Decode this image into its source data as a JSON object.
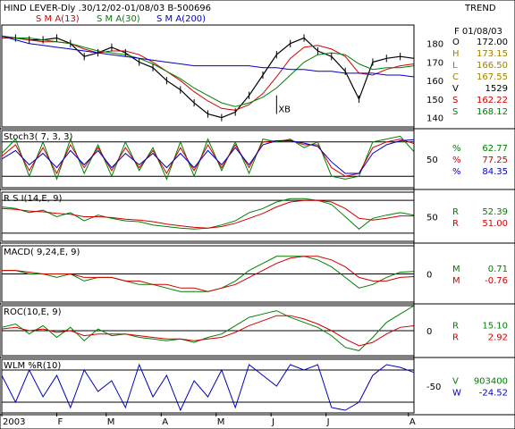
{
  "header": {
    "title": "HIND LEVER-Dly .30/12/02-01/08/03 B-500696",
    "trend": "TREND"
  },
  "colors": {
    "price": "#000000",
    "sma13": "#d00000",
    "sma30": "#008000",
    "sma200": "#0000c0",
    "grid": "#000000"
  },
  "chart_data": [
    {
      "panel": "price",
      "type": "line",
      "legend": [
        "S M A(13)",
        "S M A(30)",
        "S M A(200)"
      ],
      "yticks": [
        140,
        150,
        160,
        170,
        180
      ],
      "ylim": [
        135,
        190
      ],
      "annotation": "XB",
      "x": [
        0,
        5,
        10,
        15,
        20,
        25,
        30,
        35,
        40,
        45,
        50,
        55,
        60,
        65,
        70,
        75,
        80,
        85,
        90,
        95,
        100,
        105,
        110,
        115,
        120,
        125,
        130,
        135,
        140,
        145,
        150
      ],
      "series": [
        {
          "name": "Price",
          "values": [
            184,
            183,
            182,
            182,
            183,
            180,
            173,
            175,
            178,
            175,
            170,
            167,
            160,
            155,
            148,
            142,
            140,
            143,
            152,
            163,
            174,
            180,
            183,
            176,
            173,
            165,
            150,
            170,
            172,
            173,
            172
          ]
        },
        {
          "name": "S M A(13)",
          "values": [
            183,
            183,
            182,
            181,
            181,
            180,
            177,
            175,
            176,
            176,
            174,
            170,
            165,
            160,
            154,
            149,
            145,
            144,
            147,
            153,
            162,
            172,
            178,
            179,
            177,
            173,
            164,
            163,
            166,
            168,
            169
          ]
        },
        {
          "name": "S M A(30)",
          "values": [
            184,
            183,
            183,
            182,
            181,
            180,
            178,
            176,
            175,
            174,
            172,
            169,
            165,
            161,
            156,
            152,
            148,
            146,
            148,
            151,
            156,
            163,
            170,
            174,
            175,
            174,
            169,
            166,
            167,
            167,
            168
          ]
        },
        {
          "name": "S M A(200)",
          "values": [
            184,
            182,
            180,
            179,
            178,
            177,
            176,
            175,
            174,
            173,
            172,
            171,
            170,
            169,
            168,
            168,
            168,
            168,
            168,
            167,
            167,
            166,
            166,
            165,
            165,
            164,
            164,
            164,
            163,
            163,
            162
          ]
        }
      ],
      "readout": {
        "date": "F 01/08/03",
        "rows": [
          {
            "k": "O",
            "v": "172.00",
            "color": "#000000"
          },
          {
            "k": "H",
            "v": "173.15",
            "color": "#a08000"
          },
          {
            "k": "L",
            "v": "166.50",
            "color": "#a08000"
          },
          {
            "k": "C",
            "v": "167.55",
            "color": "#a08000"
          },
          {
            "k": "V",
            "v": "1529",
            "color": "#000000"
          },
          {
            "k": "S",
            "v": "162.22",
            "color": "#d00000"
          },
          {
            "k": "S",
            "v": "168.12",
            "color": "#008000"
          }
        ]
      }
    },
    {
      "panel": "stoch",
      "type": "line",
      "title": "Stoch3( 7, 3, 3)",
      "yticks": [
        50
      ],
      "ylim": [
        0,
        100
      ],
      "reference_lines": [
        20,
        80
      ],
      "x": [
        0,
        5,
        10,
        15,
        20,
        25,
        30,
        35,
        40,
        45,
        50,
        55,
        60,
        65,
        70,
        75,
        80,
        85,
        90,
        95,
        100,
        105,
        110,
        115,
        120,
        125,
        130,
        135,
        140,
        145,
        150
      ],
      "series": [
        {
          "name": "%K",
          "color": "#008000",
          "values": [
            60,
            85,
            20,
            80,
            15,
            85,
            25,
            75,
            20,
            80,
            30,
            70,
            15,
            80,
            20,
            85,
            30,
            80,
            25,
            85,
            80,
            85,
            70,
            80,
            20,
            15,
            20,
            80,
            85,
            90,
            63
          ]
        },
        {
          "name": "%D",
          "color": "#d00000",
          "values": [
            55,
            75,
            30,
            70,
            25,
            75,
            35,
            70,
            30,
            70,
            35,
            65,
            25,
            70,
            30,
            75,
            35,
            75,
            35,
            80,
            82,
            83,
            75,
            75,
            35,
            20,
            25,
            70,
            80,
            85,
            77
          ]
        },
        {
          "name": "%D2",
          "color": "#0000c0",
          "values": [
            50,
            65,
            40,
            60,
            35,
            65,
            40,
            65,
            35,
            60,
            40,
            60,
            35,
            60,
            35,
            65,
            40,
            70,
            40,
            75,
            82,
            82,
            78,
            72,
            45,
            25,
            25,
            60,
            75,
            82,
            84
          ]
        }
      ],
      "readout": [
        {
          "k": "%",
          "v": "62.77",
          "color": "#008000"
        },
        {
          "k": "%",
          "v": "77.25",
          "color": "#d00000"
        },
        {
          "k": "%",
          "v": "84.35",
          "color": "#0000c0"
        }
      ]
    },
    {
      "panel": "rsi",
      "type": "line",
      "title": "R S I(14,E, 9)",
      "yticks": [
        50
      ],
      "ylim": [
        20,
        80
      ],
      "reference_lines": [
        30,
        70
      ],
      "x": [
        0,
        5,
        10,
        15,
        20,
        25,
        30,
        35,
        40,
        45,
        50,
        55,
        60,
        65,
        70,
        75,
        80,
        85,
        90,
        95,
        100,
        105,
        110,
        115,
        120,
        125,
        130,
        135,
        140,
        145,
        150
      ],
      "series": [
        {
          "name": "RSI",
          "color": "#008000",
          "values": [
            62,
            60,
            55,
            58,
            50,
            55,
            45,
            52,
            48,
            45,
            44,
            40,
            38,
            36,
            35,
            36,
            40,
            45,
            55,
            60,
            68,
            72,
            72,
            70,
            65,
            50,
            35,
            48,
            52,
            55,
            52
          ]
        },
        {
          "name": "Signal",
          "color": "#d00000",
          "values": [
            60,
            59,
            57,
            56,
            54,
            53,
            50,
            50,
            49,
            47,
            46,
            44,
            41,
            39,
            37,
            36,
            38,
            42,
            48,
            54,
            62,
            68,
            70,
            70,
            68,
            60,
            48,
            46,
            48,
            51,
            51
          ]
        }
      ],
      "readout": [
        {
          "k": "R",
          "v": "52.39",
          "color": "#008000"
        },
        {
          "k": "R",
          "v": "51.00",
          "color": "#d00000"
        }
      ]
    },
    {
      "panel": "macd",
      "type": "line",
      "title": "MACD( 9,24,E, 9)",
      "yticks": [
        0
      ],
      "ylim": [
        -8,
        8
      ],
      "reference_lines": [
        0
      ],
      "x": [
        0,
        5,
        10,
        15,
        20,
        25,
        30,
        35,
        40,
        45,
        50,
        55,
        60,
        65,
        70,
        75,
        80,
        85,
        90,
        95,
        100,
        105,
        110,
        115,
        120,
        125,
        130,
        135,
        140,
        145,
        150
      ],
      "series": [
        {
          "name": "MACD",
          "color": "#008000",
          "values": [
            1,
            1,
            0,
            0,
            -1,
            0,
            -2,
            -1,
            -1,
            -2,
            -3,
            -3,
            -4,
            -5,
            -5,
            -5,
            -4,
            -2,
            1,
            3,
            5,
            5,
            5,
            4,
            2,
            -1,
            -4,
            -3,
            -1,
            0.5,
            0.71
          ]
        },
        {
          "name": "Signal",
          "color": "#d00000",
          "values": [
            1,
            1,
            0.5,
            0,
            0,
            0,
            -1,
            -1,
            -1,
            -2,
            -2,
            -3,
            -3,
            -4,
            -4,
            -5,
            -4,
            -3,
            -1,
            1,
            3,
            4.5,
            5,
            5,
            4,
            2,
            -1,
            -2,
            -2,
            -1,
            -0.76
          ]
        }
      ],
      "readout": [
        {
          "k": "M",
          "v": "0.71",
          "color": "#008000"
        },
        {
          "k": "M",
          "v": "-0.76",
          "color": "#d00000"
        }
      ]
    },
    {
      "panel": "roc",
      "type": "line",
      "title": "ROC(10,E, 9)",
      "yticks": [
        0
      ],
      "ylim": [
        -15,
        15
      ],
      "reference_lines": [
        0
      ],
      "x": [
        0,
        5,
        10,
        15,
        20,
        25,
        30,
        35,
        40,
        45,
        50,
        55,
        60,
        65,
        70,
        75,
        80,
        85,
        90,
        95,
        100,
        105,
        110,
        115,
        120,
        125,
        130,
        135,
        140,
        145,
        150
      ],
      "series": [
        {
          "name": "ROC",
          "color": "#008000",
          "values": [
            2,
            4,
            -2,
            3,
            -4,
            2,
            -6,
            1,
            -3,
            -2,
            -4,
            -5,
            -6,
            -5,
            -7,
            -4,
            -2,
            3,
            8,
            10,
            12,
            8,
            5,
            2,
            -3,
            -10,
            -12,
            -4,
            5,
            10,
            15
          ]
        },
        {
          "name": "Signal",
          "color": "#d00000",
          "values": [
            1,
            2,
            0,
            1,
            -1,
            0,
            -3,
            -2,
            -2,
            -2,
            -3,
            -4,
            -5,
            -5,
            -6,
            -5,
            -4,
            -1,
            3,
            6,
            9,
            9,
            7,
            4,
            0,
            -5,
            -9,
            -7,
            -2,
            2,
            2.92
          ]
        }
      ],
      "readout": [
        {
          "k": "R",
          "v": "15.10",
          "color": "#008000"
        },
        {
          "k": "R",
          "v": "2.92",
          "color": "#d00000"
        }
      ]
    },
    {
      "panel": "wlm",
      "type": "line",
      "title": "WLM %R(10)",
      "yticks": [
        -50
      ],
      "ylim": [
        -100,
        0
      ],
      "reference_lines": [
        -20,
        -80
      ],
      "x": [
        0,
        5,
        10,
        15,
        20,
        25,
        30,
        35,
        40,
        45,
        50,
        55,
        60,
        65,
        70,
        75,
        80,
        85,
        90,
        95,
        100,
        105,
        110,
        115,
        120,
        125,
        130,
        135,
        140,
        145,
        150
      ],
      "series": [
        {
          "name": "%R",
          "color": "#0000c0",
          "values": [
            -30,
            -80,
            -20,
            -70,
            -30,
            -90,
            -20,
            -60,
            -40,
            -90,
            -10,
            -70,
            -30,
            -95,
            -40,
            -70,
            -20,
            -90,
            -10,
            -30,
            -50,
            -10,
            -20,
            -10,
            -90,
            -95,
            -80,
            -30,
            -10,
            -15,
            -24.52
          ]
        }
      ],
      "readout": [
        {
          "k": "V",
          "v": "903400",
          "color": "#008000"
        },
        {
          "k": "W",
          "v": "-24.52",
          "color": "#0000c0"
        }
      ]
    }
  ],
  "xaxis": {
    "labels": [
      "2003",
      "F",
      "M",
      "A",
      "M",
      "J",
      "J",
      "A"
    ],
    "positions": [
      0,
      20,
      38,
      58,
      78,
      98,
      118,
      148
    ],
    "xlim": [
      0,
      150
    ]
  }
}
